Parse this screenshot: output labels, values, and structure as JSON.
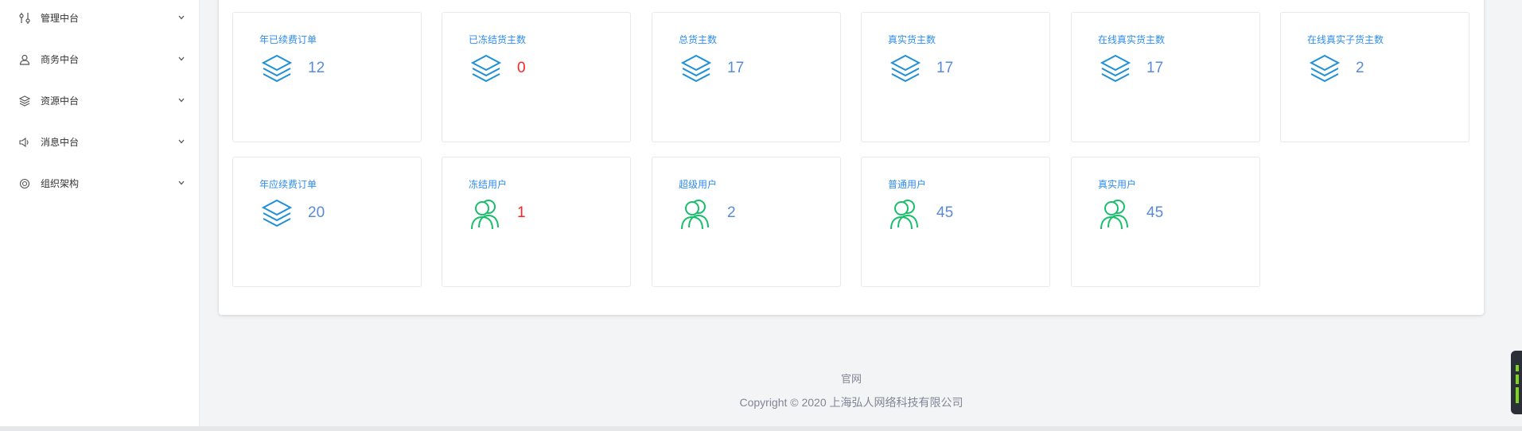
{
  "sidebar": {
    "items": [
      {
        "label": "管理中台",
        "icon": "sliders-icon"
      },
      {
        "label": "商务中台",
        "icon": "user-icon"
      },
      {
        "label": "资源中台",
        "icon": "layers-icon"
      },
      {
        "label": "消息中台",
        "icon": "speaker-icon"
      },
      {
        "label": "组织架构",
        "icon": "circle-icon"
      }
    ]
  },
  "stats": {
    "row1": [
      {
        "title": "年已续费订单",
        "value": "12",
        "icon": "layers-icon",
        "value_color": "blue"
      },
      {
        "title": "已冻结货主数",
        "value": "0",
        "icon": "layers-icon",
        "value_color": "red"
      },
      {
        "title": "总货主数",
        "value": "17",
        "icon": "layers-icon",
        "value_color": "blue"
      },
      {
        "title": "真实货主数",
        "value": "17",
        "icon": "layers-icon",
        "value_color": "blue"
      },
      {
        "title": "在线真实货主数",
        "value": "17",
        "icon": "layers-icon",
        "value_color": "blue"
      },
      {
        "title": "在线真实子货主数",
        "value": "2",
        "icon": "layers-icon",
        "value_color": "blue"
      }
    ],
    "row2": [
      {
        "title": "年应续费订单",
        "value": "20",
        "icon": "layers-icon",
        "value_color": "blue"
      },
      {
        "title": "冻结用户",
        "value": "1",
        "icon": "users-icon",
        "value_color": "red"
      },
      {
        "title": "超级用户",
        "value": "2",
        "icon": "users-icon",
        "value_color": "blue"
      },
      {
        "title": "普通用户",
        "value": "45",
        "icon": "users-icon",
        "value_color": "blue"
      },
      {
        "title": "真实用户",
        "value": "45",
        "icon": "users-icon",
        "value_color": "blue"
      }
    ]
  },
  "footer": {
    "link": "官网",
    "copyright": "Copyright © 2020 上海弘人网络科技有限公司"
  },
  "colors": {
    "title_blue": "#2d8cf0",
    "value_blue": "#5a8bd8",
    "value_red": "#ff2323",
    "layers_icon": "#1e90d8",
    "users_icon": "#19be6b"
  }
}
